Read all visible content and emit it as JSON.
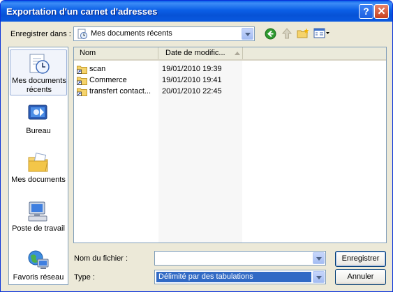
{
  "window": {
    "title": "Exportation d'un carnet d'adresses",
    "help_label": "?",
    "close_label": "✕"
  },
  "toolbar": {
    "save_in_label": "Enregistrer dans :",
    "save_in_value": "Mes documents récents",
    "icons": [
      "back-icon",
      "up-folder-icon",
      "new-folder-icon",
      "views-menu-icon"
    ]
  },
  "places": [
    {
      "label": "Mes documents récents",
      "icon": "recent-documents-icon"
    },
    {
      "label": "Bureau",
      "icon": "desktop-icon"
    },
    {
      "label": "Mes documents",
      "icon": "my-documents-icon"
    },
    {
      "label": "Poste de travail",
      "icon": "my-computer-icon"
    },
    {
      "label": "Favoris réseau",
      "icon": "network-places-icon"
    }
  ],
  "file_list": {
    "columns": [
      "Nom",
      "Date de modific..."
    ],
    "rows": [
      {
        "name": "scan",
        "date": "19/01/2010 19:39"
      },
      {
        "name": "Commerce",
        "date": "19/01/2010 19:41"
      },
      {
        "name": "transfert contact...",
        "date": "20/01/2010 22:45"
      }
    ]
  },
  "form": {
    "filename_label": "Nom du fichier :",
    "filename_value": "",
    "type_label": "Type :",
    "type_value": "Délimité par des tabulations"
  },
  "buttons": {
    "save": "Enregistrer",
    "cancel": "Annuler"
  },
  "colors": {
    "titlebar": "#0a5ee8",
    "selection": "#316ac5",
    "dialog_bg": "#ece9d8"
  }
}
